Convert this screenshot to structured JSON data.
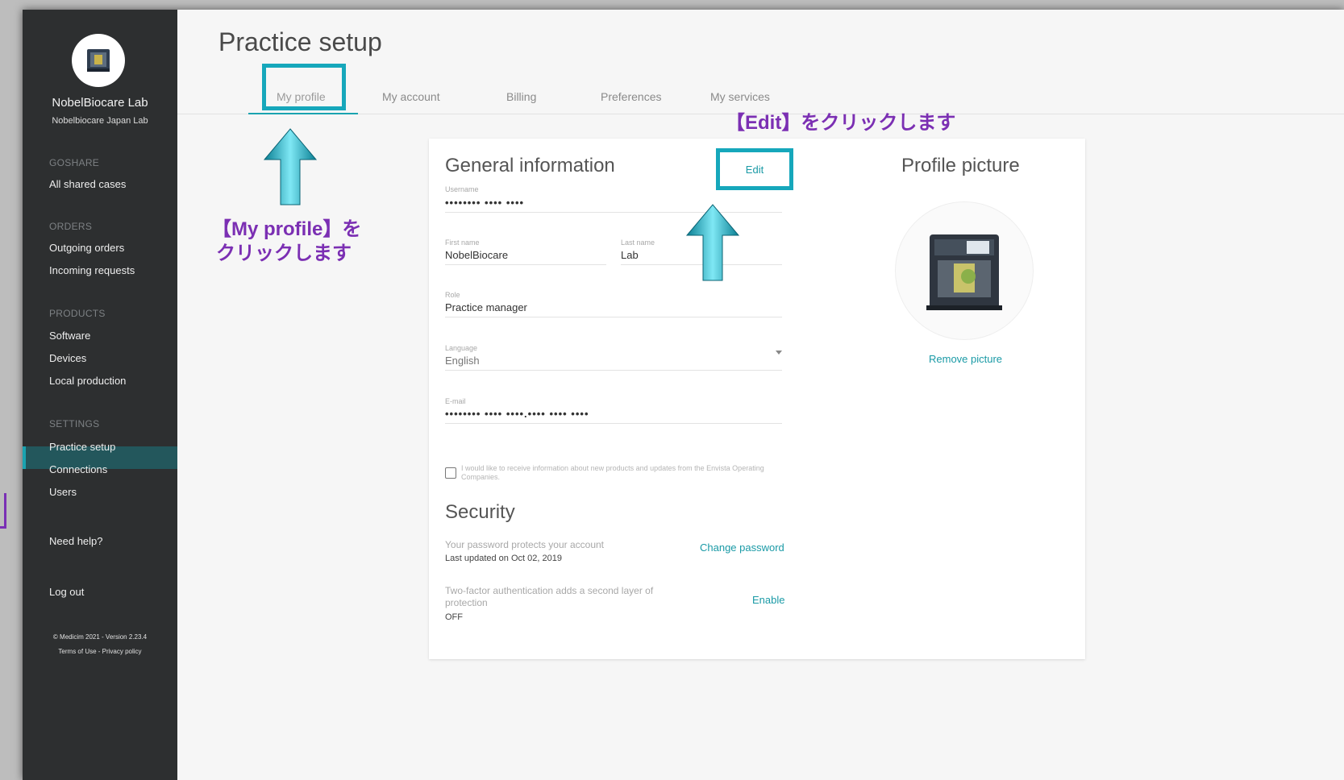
{
  "colors": {
    "accent": "#16a7bb",
    "annotation": "#7b2fb3",
    "sidebar_bg": "#2d2f30",
    "active_nav": "#23575c"
  },
  "sidebar": {
    "org_name": "NobelBiocare Lab",
    "org_sub": "Nobelbiocare Japan Lab",
    "sections": {
      "goshare": "GOSHARE",
      "orders": "ORDERS",
      "products": "PRODUCTS",
      "settings": "SETTINGS"
    },
    "items": {
      "all_shared_cases": "All shared cases",
      "outgoing_orders": "Outgoing orders",
      "incoming_requests": "Incoming requests",
      "software": "Software",
      "devices": "Devices",
      "local_production": "Local production",
      "practice_setup": "Practice setup",
      "connections": "Connections",
      "users": "Users",
      "need_help": "Need help?",
      "log_out": "Log out"
    },
    "footer_version": "© Medicim 2021 - Version 2.23.4",
    "footer_links": "Terms of Use - Privacy policy"
  },
  "header": {
    "title": "Practice setup"
  },
  "tabs": [
    "My profile",
    "My account",
    "Billing",
    "Preferences",
    "My services"
  ],
  "annotations": {
    "my_profile_line1": "【My profile】を",
    "my_profile_line2": "クリックします",
    "edit": "【Edit】をクリックします"
  },
  "general": {
    "title": "General information",
    "edit_label": "Edit",
    "username_label": "Username",
    "username_value": "•••••••• •••• ••••",
    "first_name_label": "First name",
    "first_name_value": "NobelBiocare",
    "last_name_label": "Last name",
    "last_name_value": "Lab",
    "role_label": "Role",
    "role_value": "Practice manager",
    "language_label": "Language",
    "language_value": "English",
    "email_label": "E-mail",
    "email_value": "•••••••• •••• ••••.•••• •••• ••••",
    "consent_text": "I would like to receive information about new products and updates from the Envista Operating Companies."
  },
  "security": {
    "title": "Security",
    "password_desc": "Your password protects your account",
    "password_updated": "Last updated on Oct 02, 2019",
    "change_password": "Change password",
    "twofa_desc": "Two-factor authentication adds a second layer of protection",
    "twofa_status": "OFF",
    "enable": "Enable"
  },
  "profile_picture": {
    "title": "Profile picture",
    "remove": "Remove picture"
  }
}
